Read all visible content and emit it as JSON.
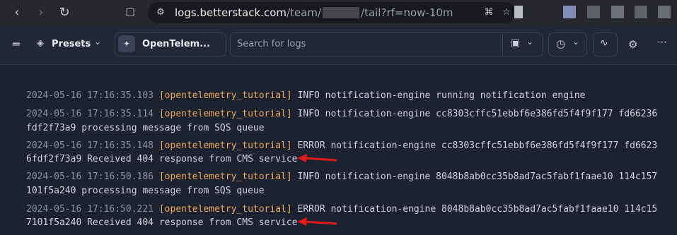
{
  "browser": {
    "url_host": "logs.betterstack.com",
    "url_path_1": "/team/",
    "url_path_2": "/tail?rf=now-10m",
    "icons": [
      "back-icon",
      "forward-icon",
      "reload-icon",
      "bookmark-icon",
      "site-settings-icon",
      "share-icon"
    ]
  },
  "toolbar": {
    "presets_label": "Presets",
    "source_label": "OpenTelem...",
    "search_placeholder": "Search for logs"
  },
  "logs": [
    {
      "ts": "2024-05-16 17:16:35.103",
      "src": "[opentelemetry_tutorial]",
      "l1": " INFO notification-engine running notification engine",
      "l2": ""
    },
    {
      "ts": "2024-05-16 17:16:35.114",
      "src": "[opentelemetry_tutorial]",
      "l1": " INFO notification-engine cc8303cffc51ebbf6e386fd5f4f9f177 fd66236",
      "l2": "fdf2f73a9 processing message from SQS queue"
    },
    {
      "ts": "2024-05-16 17:16:35.148",
      "src": "[opentelemetry_tutorial]",
      "l1": " ERROR notification-engine cc8303cffc51ebbf6e386fd5f4f9f177 fd6623",
      "l2": "6fdf2f73a9 Received 404 response from CMS service"
    },
    {
      "ts": "2024-05-16 17:16:50.186",
      "src": "[opentelemetry_tutorial]",
      "l1": " INFO notification-engine 8048b8ab0cc35b8ad7ac5fabf1faae10 114c157",
      "l2": "101f5a240 processing message from SQS queue"
    },
    {
      "ts": "2024-05-16 17:16:50.221",
      "src": "[opentelemetry_tutorial]",
      "l1": " ERROR notification-engine 8048b8ab0cc35b8ad7ac5fabf1faae10 114c15",
      "l2": "7101f5a240 Received 404 response from CMS service"
    }
  ],
  "annotation_color": "#e01b1b"
}
